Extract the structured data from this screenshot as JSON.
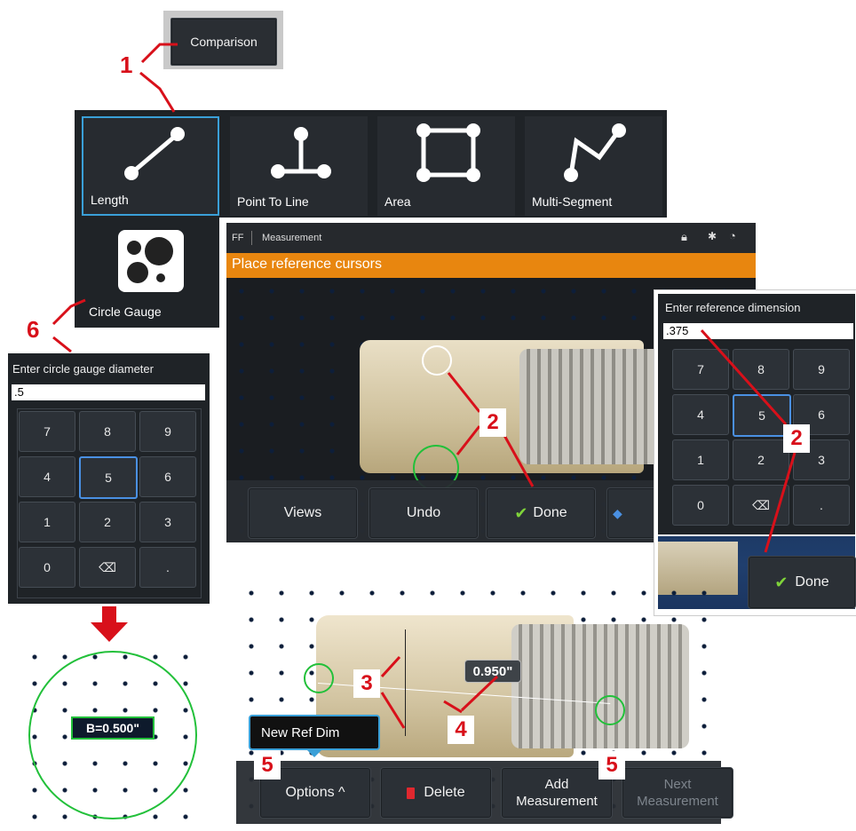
{
  "comparison_button": "Comparison",
  "tools": {
    "length": "Length",
    "point_to_line": "Point To Line",
    "area": "Area",
    "multi_segment": "Multi-Segment",
    "circle_gauge": "Circle Gauge"
  },
  "circle_keypad": {
    "prompt": "Enter circle gauge diameter",
    "value": ".5",
    "keys": [
      "7",
      "8",
      "9",
      "4",
      "5",
      "6",
      "1",
      "2",
      "3",
      "0",
      "⌫",
      "."
    ],
    "selected": "5"
  },
  "circle_result": "B=0.500\"",
  "main_screen": {
    "mode": "FF",
    "title": "Measurement",
    "banner": "Place reference cursors",
    "buttons": {
      "views": "Views",
      "undo": "Undo",
      "done": "Done"
    }
  },
  "ref_keypad": {
    "prompt": "Enter reference dimension",
    "value": ".375",
    "keys": [
      "7",
      "8",
      "9",
      "4",
      "5",
      "6",
      "1",
      "2",
      "3",
      "0",
      "⌫",
      "."
    ],
    "selected": "5",
    "done": "Done"
  },
  "bottom_screen": {
    "measurement": "0.950\"",
    "tooltip": "New Ref Dim",
    "buttons": {
      "options": "Options ^",
      "delete": "Delete",
      "add_line1": "Add",
      "add_line2": "Measurement",
      "next_line1": "Next",
      "next_line2": "Measurement"
    }
  },
  "callouts": {
    "c1": "1",
    "c2a": "2",
    "c2b": "2",
    "c3": "3",
    "c4": "4",
    "c5a": "5",
    "c5b": "5",
    "c6": "6"
  },
  "colors": {
    "accent_red": "#d8101a",
    "banner_orange": "#e8860f",
    "selection_blue": "#4a90e2",
    "gauge_green": "#22c03a"
  }
}
